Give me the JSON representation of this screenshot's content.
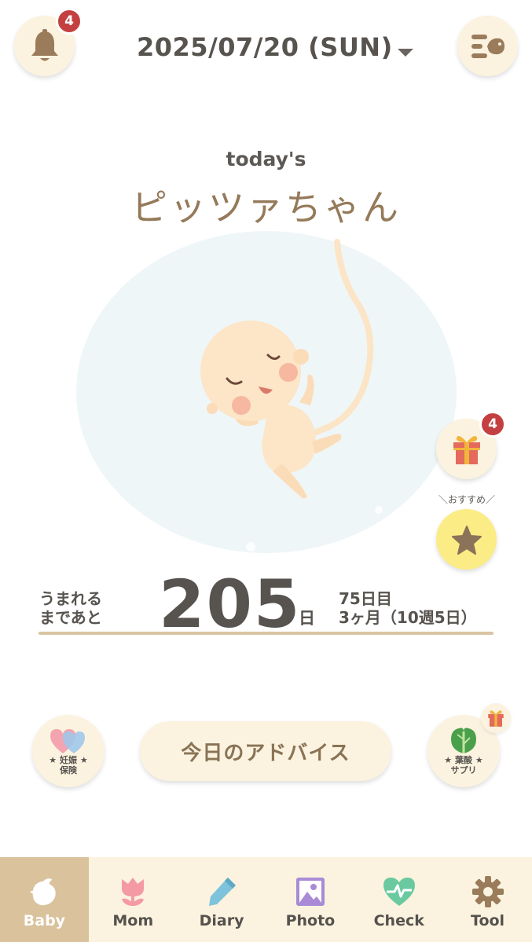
{
  "header": {
    "notification_count": "4",
    "date": "2025/07/20 (SUN)"
  },
  "hero": {
    "todays_label": "today's",
    "baby_name": "ピッツァちゃん"
  },
  "side": {
    "gift_count": "4",
    "osusume_label": "＼おすすめ／"
  },
  "countdown": {
    "left_line1": "うまれる",
    "left_line2": "まであと",
    "days_remaining": "205",
    "unit": "日",
    "right_line1": "75日目",
    "right_line2": "3ヶ月（10週5日）"
  },
  "actions": {
    "insurance_line1": "★ 妊娠 ★",
    "insurance_line2": "保険",
    "advice_label": "今日のアドバイス",
    "supply_line1": "★ 葉酸 ★",
    "supply_line2": "サプリ"
  },
  "tabs": [
    {
      "label": "Baby",
      "icon": "bird-icon"
    },
    {
      "label": "Mom",
      "icon": "tulip-icon"
    },
    {
      "label": "Diary",
      "icon": "pencil-icon"
    },
    {
      "label": "Photo",
      "icon": "photo-icon"
    },
    {
      "label": "Check",
      "icon": "heart-pulse-icon"
    },
    {
      "label": "Tool",
      "icon": "gear-icon"
    }
  ],
  "colors": {
    "accent": "#d9c29c",
    "button_bg": "#fbf3df",
    "badge": "#c44040",
    "star_bg": "#fbec86",
    "name": "#957a5a"
  }
}
